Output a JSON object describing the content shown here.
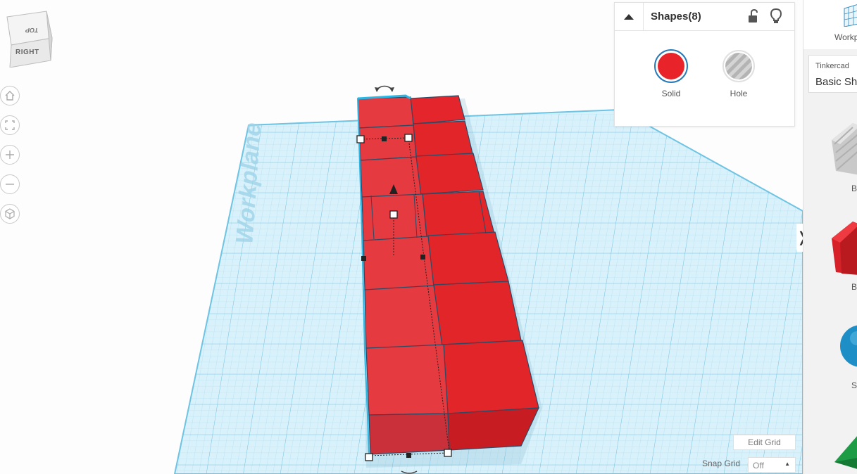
{
  "colors": {
    "solid": "#e8242a",
    "selection_outline": "#2bb7e6",
    "grid_line": "#7fcce8",
    "workplane_bg": "#d7f0fb",
    "box_face": "#e3282e"
  },
  "viewcube": {
    "top_label": "TOP",
    "right_label": "RIGHT"
  },
  "view_tools": [
    {
      "icon": "home-icon",
      "label": "home-view"
    },
    {
      "icon": "fit-all-icon",
      "label": "fit-all"
    },
    {
      "icon": "zoom-in-icon",
      "label": "zoom-in"
    },
    {
      "icon": "zoom-out-icon",
      "label": "zoom-out"
    },
    {
      "icon": "perspective-icon",
      "label": "ortho-perspective"
    }
  ],
  "workplane_text": "Workplane",
  "shapes_panel": {
    "title": "Shapes(8)",
    "solid_label": "Solid",
    "hole_label": "Hole",
    "icons": [
      "chevron-up-icon",
      "lock-icon",
      "lightbulb-icon"
    ]
  },
  "grid_controls": {
    "edit_grid": "Edit Grid",
    "snap_grid_label": "Snap Grid",
    "snap_grid_value": "Off"
  },
  "sidebar": {
    "workplane_tool_label": "Workp",
    "library_category": "Tinkercad",
    "library_name": "Basic Sh",
    "shapes": [
      {
        "icon": "box-hole-icon",
        "label": "Bo"
      },
      {
        "icon": "box-icon",
        "label": "Bo"
      },
      {
        "icon": "sphere-icon",
        "label": "Sph"
      },
      {
        "icon": "roof-icon",
        "label": ""
      }
    ],
    "toggle_icon": "chevron-right-icon"
  }
}
